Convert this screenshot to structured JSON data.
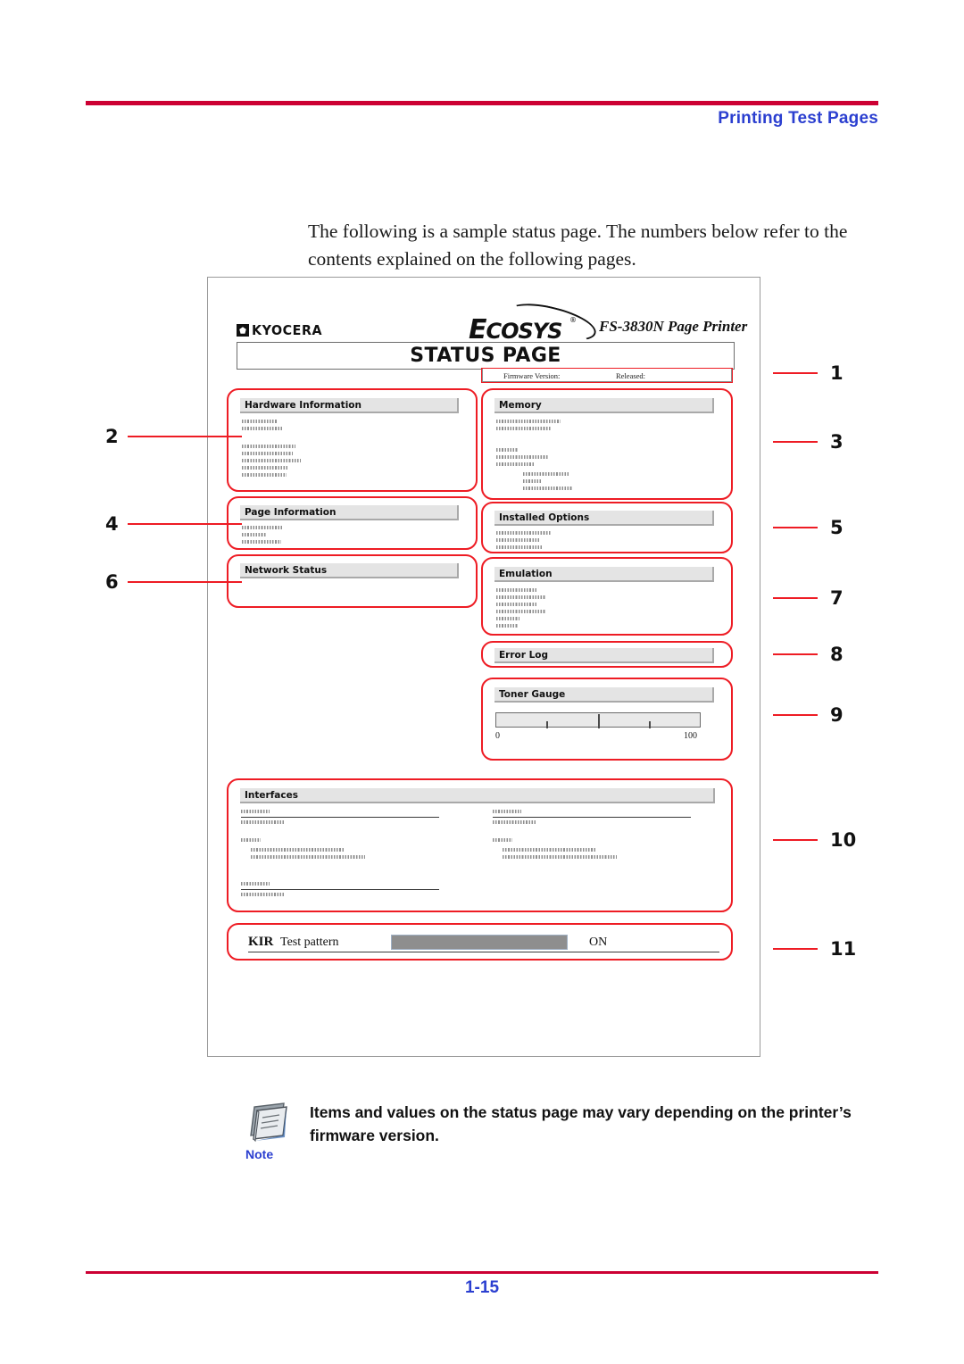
{
  "header": {
    "title": "Printing Test Pages"
  },
  "intro": {
    "text": "The following is a sample status page. The numbers below refer to the contents explained on the following pages."
  },
  "status_page": {
    "brand": {
      "kyocera": "KYOCERA",
      "ecosys_e": "E",
      "ecosys_rest": "COSYS",
      "registered": "®",
      "model": "FS-3830N  Page Printer"
    },
    "title": "STATUS PAGE",
    "firmware_row": {
      "firmware_label": "Firmware Version:",
      "released_label": "Released:"
    },
    "sections": {
      "hardware_information": "Hardware Information",
      "memory": "Memory",
      "page_information": "Page Information",
      "installed_options": "Installed Options",
      "network_status": "Network Status",
      "emulation": "Emulation",
      "error_log": "Error Log",
      "toner_gauge": "Toner Gauge",
      "interfaces": "Interfaces"
    },
    "toner_gauge": {
      "min": "0",
      "max": "100"
    },
    "kir": {
      "label": "KIR",
      "description": "Test pattern",
      "value": "ON"
    }
  },
  "callouts": {
    "c1": "1",
    "c2": "2",
    "c3": "3",
    "c4": "4",
    "c5": "5",
    "c6": "6",
    "c7": "7",
    "c8": "8",
    "c9": "9",
    "c10": "10",
    "c11": "11"
  },
  "note": {
    "label": "Note",
    "text": "Items and values on the status page may vary depending on the printer’s firmware version."
  },
  "footer": {
    "page_number": "1-15"
  },
  "colors": {
    "accent_blue": "#2b3fd0",
    "rule_crimson": "#cc0033",
    "callout_red": "#ee1c24",
    "section_header_gray": "#e4e4e4"
  }
}
